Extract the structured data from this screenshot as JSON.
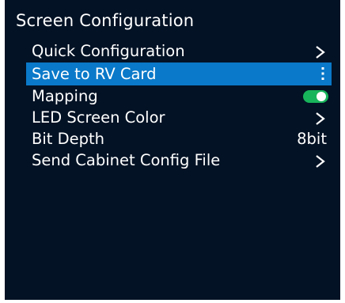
{
  "title": "Screen Configuration",
  "colors": {
    "background": "#031225",
    "selected": "#0a79c9",
    "toggle_on": "#18b45b",
    "text": "#ffffff"
  },
  "menu": {
    "items": [
      {
        "label": "Quick Configuration",
        "right": "chevron-right-icon"
      },
      {
        "label": "Save to RV Card",
        "right": "more-vertical-icon",
        "selected": true
      },
      {
        "label": "Mapping",
        "right": "toggle",
        "toggle_on": true
      },
      {
        "label": "LED Screen Color",
        "right": "chevron-right-icon"
      },
      {
        "label": "Bit Depth",
        "value": "8bit"
      },
      {
        "label": "Send Cabinet Config File",
        "right": "chevron-right-icon"
      }
    ]
  }
}
